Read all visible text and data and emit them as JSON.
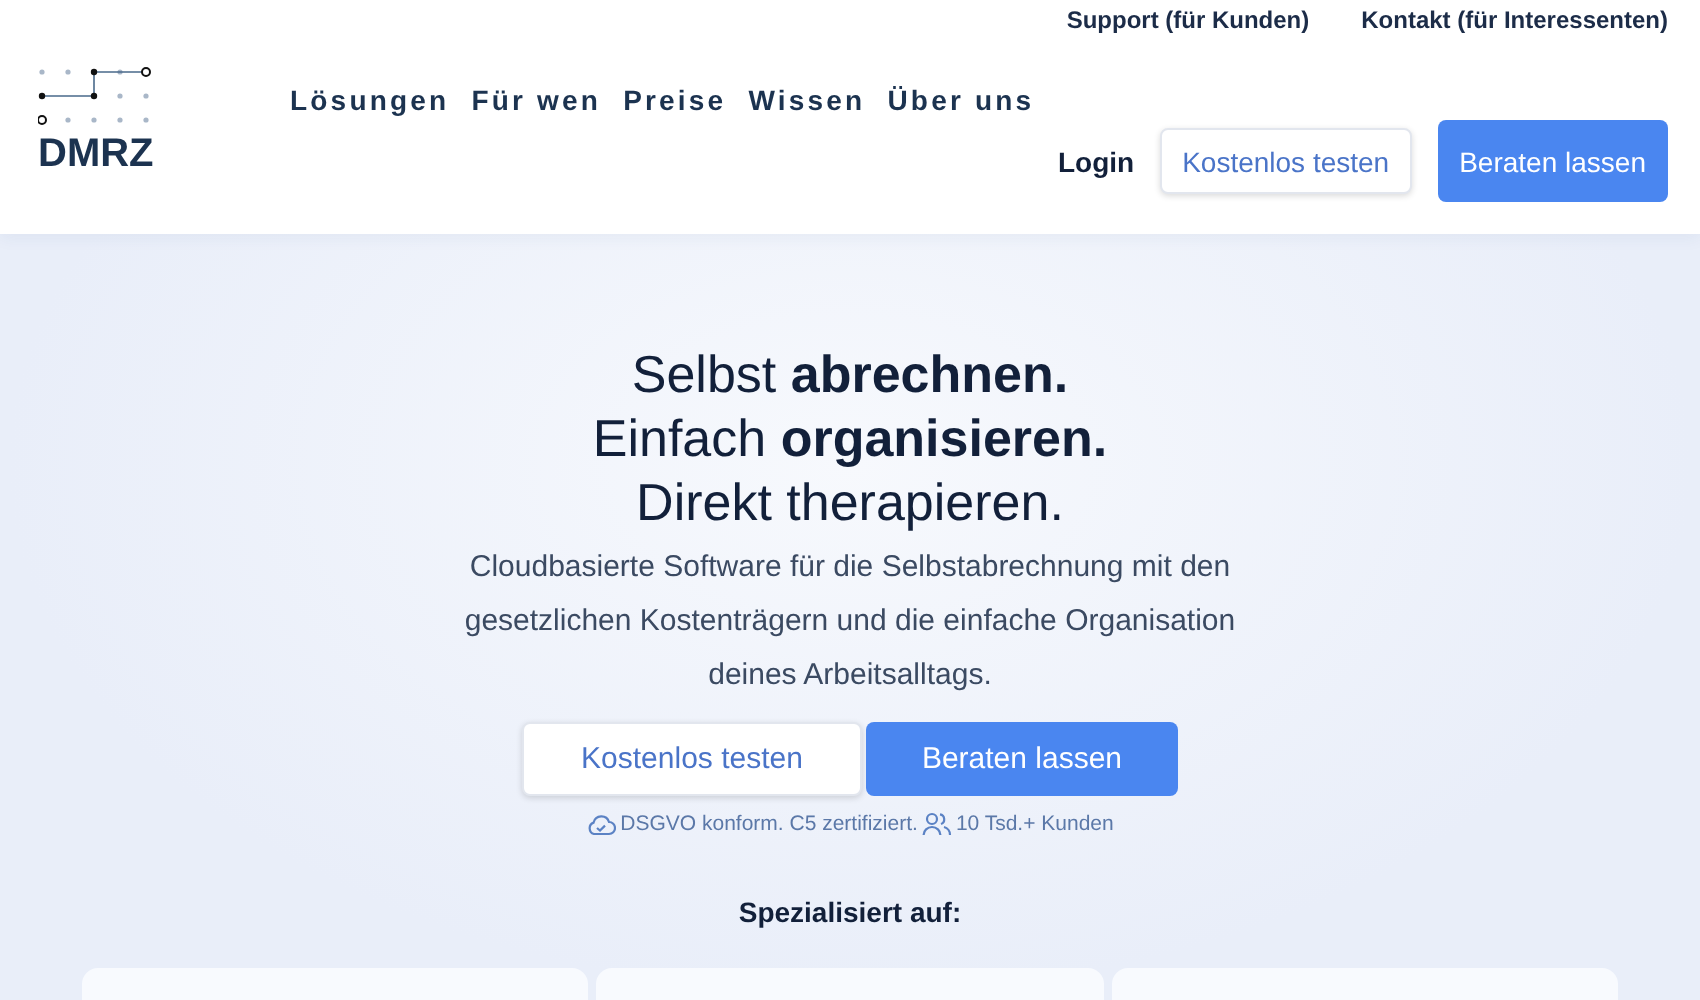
{
  "top_links": [
    "Support (für Kunden)",
    "Kontakt (für Interessenten)"
  ],
  "logo": {
    "text": "DMRZ"
  },
  "nav": [
    "Lösungen",
    "Für wen",
    "Preise",
    "Wissen",
    "Über uns"
  ],
  "header_actions": [
    {
      "label": "Login",
      "kind": "link"
    },
    {
      "label": "Kostenlos testen",
      "kind": "secondary"
    },
    {
      "label": "Beraten lassen",
      "kind": "primary"
    }
  ],
  "hero": {
    "headline": [
      "Selbst **abrechnen.**",
      "Einfach **organisieren.**",
      "Direkt therapieren."
    ],
    "description": "Cloudbasierte Software für die Selbstabrechnung mit den gesetzlichen Kostenträgern und die einfache Organisation deines Arbeitsalltags.",
    "buttons": [
      {
        "label": "Kostenlos testen",
        "kind": "secondary"
      },
      {
        "label": "Beraten lassen",
        "kind": "primary"
      }
    ],
    "badges": [
      {
        "text": "DSGVO konform. C5 zertifiziert.",
        "kind": "cloud"
      },
      {
        "text": "10 Tsd.+ Kunden",
        "kind": "users"
      }
    ],
    "specialized_heading": "Spezialisiert auf:"
  }
}
